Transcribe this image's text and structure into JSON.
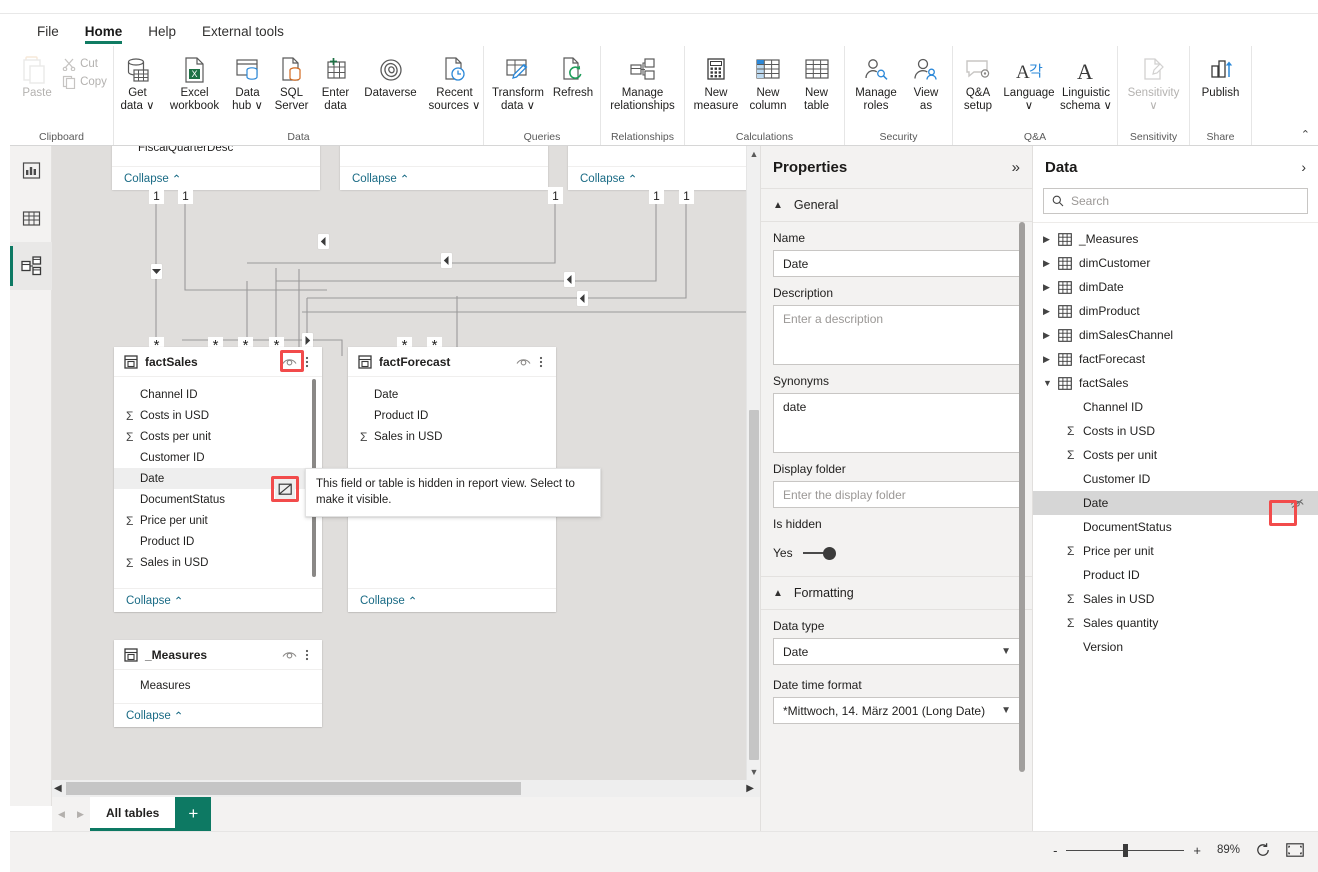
{
  "ribbon": {
    "tabs": [
      {
        "label": "File",
        "active": false
      },
      {
        "label": "Home",
        "active": true
      },
      {
        "label": "Help",
        "active": false
      },
      {
        "label": "External tools",
        "active": false
      }
    ],
    "groups": [
      {
        "name": "Clipboard",
        "label": "Clipboard",
        "paste": "Paste",
        "cut": "Cut",
        "copy": "Copy"
      },
      {
        "name": "Data",
        "label": "Data",
        "buttons": [
          {
            "line1": "Get",
            "line2": "data ∨",
            "icon": "get-data-icon"
          },
          {
            "line1": "Excel",
            "line2": "workbook",
            "icon": "excel-workbook-icon"
          },
          {
            "line1": "Data",
            "line2": "hub ∨",
            "icon": "data-hub-icon"
          },
          {
            "line1": "SQL",
            "line2": "Server",
            "icon": "sql-server-icon"
          },
          {
            "line1": "Enter",
            "line2": "data",
            "icon": "enter-data-icon"
          },
          {
            "line1": "Dataverse",
            "line2": "",
            "icon": "dataverse-icon"
          },
          {
            "line1": "Recent",
            "line2": "sources ∨",
            "icon": "recent-sources-icon"
          }
        ]
      },
      {
        "name": "Queries",
        "label": "Queries",
        "buttons": [
          {
            "line1": "Transform",
            "line2": "data ∨",
            "icon": "transform-data-icon"
          },
          {
            "line1": "Refresh",
            "line2": "",
            "icon": "refresh-icon"
          }
        ]
      },
      {
        "name": "Relationships",
        "label": "Relationships",
        "buttons": [
          {
            "line1": "Manage",
            "line2": "relationships",
            "icon": "manage-relationships-icon"
          }
        ]
      },
      {
        "name": "Calculations",
        "label": "Calculations",
        "buttons": [
          {
            "line1": "New",
            "line2": "measure",
            "icon": "new-measure-icon"
          },
          {
            "line1": "New",
            "line2": "column",
            "icon": "new-column-icon"
          },
          {
            "line1": "New",
            "line2": "table",
            "icon": "new-table-icon"
          }
        ]
      },
      {
        "name": "Security",
        "label": "Security",
        "buttons": [
          {
            "line1": "Manage",
            "line2": "roles",
            "icon": "manage-roles-icon"
          },
          {
            "line1": "View",
            "line2": "as",
            "icon": "view-as-icon"
          }
        ]
      },
      {
        "name": "Q&A",
        "label": "Q&A",
        "buttons": [
          {
            "line1": "Q&A",
            "line2": "setup",
            "icon": "qa-setup-icon"
          },
          {
            "line1": "Language",
            "line2": "∨",
            "icon": "language-icon"
          },
          {
            "line1": "Linguistic",
            "line2": "schema ∨",
            "icon": "linguistic-schema-icon"
          }
        ]
      },
      {
        "name": "Sensitivity",
        "label": "Sensitivity",
        "buttons": [
          {
            "line1": "Sensitivity",
            "line2": "∨",
            "icon": "sensitivity-icon",
            "disabled": true
          }
        ]
      },
      {
        "name": "Share",
        "label": "Share",
        "buttons": [
          {
            "line1": "Publish",
            "line2": "",
            "icon": "publish-icon"
          }
        ]
      }
    ],
    "collapse_caret": "⌃"
  },
  "rail": {
    "items": [
      {
        "name": "report-view",
        "icon": "report-chart-icon",
        "active": false
      },
      {
        "name": "table-view",
        "icon": "grid-table-icon",
        "active": false
      },
      {
        "name": "model-view",
        "icon": "model-diagram-icon",
        "active": true
      }
    ]
  },
  "canvas": {
    "top_tables": [
      {
        "last_field": "FiscalQuarterDesc",
        "collapse": "Collapse"
      },
      {
        "last_field": "",
        "collapse": "Collapse"
      },
      {
        "last_field": "",
        "collapse": "Collapse"
      }
    ],
    "tables": [
      {
        "name": "factSales",
        "collapse": "Collapse",
        "fields": [
          {
            "label": "Channel ID",
            "agg": false
          },
          {
            "label": "Costs in USD",
            "agg": true
          },
          {
            "label": "Costs per unit",
            "agg": true
          },
          {
            "label": "Customer ID",
            "agg": false
          },
          {
            "label": "Date",
            "agg": false,
            "selected": true
          },
          {
            "label": "DocumentStatus",
            "agg": false
          },
          {
            "label": "Price per unit",
            "agg": true
          },
          {
            "label": "Product ID",
            "agg": false
          },
          {
            "label": "Sales in USD",
            "agg": true
          }
        ]
      },
      {
        "name": "factForecast",
        "collapse": "Collapse",
        "fields": [
          {
            "label": "Date",
            "agg": false
          },
          {
            "label": "Product ID",
            "agg": false
          },
          {
            "label": "Sales in USD",
            "agg": true
          }
        ]
      },
      {
        "name": "_Measures",
        "collapse": "Collapse",
        "fields": [
          {
            "label": "Measures",
            "agg": false
          }
        ]
      }
    ],
    "cardinality_one": "1",
    "cardinality_many": "*",
    "tooltip": "This field or table is hidden in report view. Select to make it visible."
  },
  "tabbar": {
    "page_tab": "All tables",
    "add_label": "+"
  },
  "status": {
    "zoom_minus": "-",
    "zoom_plus": "+",
    "zoom_level": "89%",
    "reset_icon": "refresh-fit-icon",
    "fit_icon": "fit-to-screen-icon"
  },
  "properties": {
    "title": "Properties",
    "collapse_icon": "»",
    "sections": [
      {
        "name": "General",
        "caret": "⌃"
      },
      {
        "name": "Formatting",
        "caret": "⌃"
      }
    ],
    "fields": {
      "name_label": "Name",
      "name_value": "Date",
      "description_label": "Description",
      "description_placeholder": "Enter a description",
      "synonyms_label": "Synonyms",
      "synonyms_value": "date",
      "display_folder_label": "Display folder",
      "display_folder_placeholder": "Enter the display folder",
      "is_hidden_label": "Is hidden",
      "is_hidden_value": "Yes",
      "data_type_label": "Data type",
      "data_type_value": "Date",
      "date_format_label": "Date time format",
      "date_format_value": "*Mittwoch, 14. März 2001 (Long Date)"
    }
  },
  "data_pane": {
    "title": "Data",
    "collapse_icon": "›",
    "search_placeholder": "Search",
    "search_icon": "search-icon",
    "tables": [
      {
        "label": "_Measures",
        "expanded": false
      },
      {
        "label": "dimCustomer",
        "expanded": false
      },
      {
        "label": "dimDate",
        "expanded": false
      },
      {
        "label": "dimProduct",
        "expanded": false
      },
      {
        "label": "dimSalesChannel",
        "expanded": false
      },
      {
        "label": "factForecast",
        "expanded": false
      },
      {
        "label": "factSales",
        "expanded": true
      }
    ],
    "fact_sales_fields": [
      {
        "label": "Channel ID",
        "agg": false
      },
      {
        "label": "Costs in USD",
        "agg": true
      },
      {
        "label": "Costs per unit",
        "agg": true
      },
      {
        "label": "Customer ID",
        "agg": false
      },
      {
        "label": "Date",
        "agg": false,
        "selected": true,
        "eye": "hidden-eye-icon"
      },
      {
        "label": "DocumentStatus",
        "agg": false
      },
      {
        "label": "Price per unit",
        "agg": true
      },
      {
        "label": "Product ID",
        "agg": false
      },
      {
        "label": "Sales in USD",
        "agg": true
      },
      {
        "label": "Sales quantity",
        "agg": true
      },
      {
        "label": "Version",
        "agg": false
      }
    ]
  },
  "colors": {
    "accent_teal": "#0d7963",
    "highlight_red": "#f24b4b",
    "canvas_bg": "#e0dedc",
    "panel_bg": "#f3f2f1",
    "link_teal": "#1a6b85"
  }
}
